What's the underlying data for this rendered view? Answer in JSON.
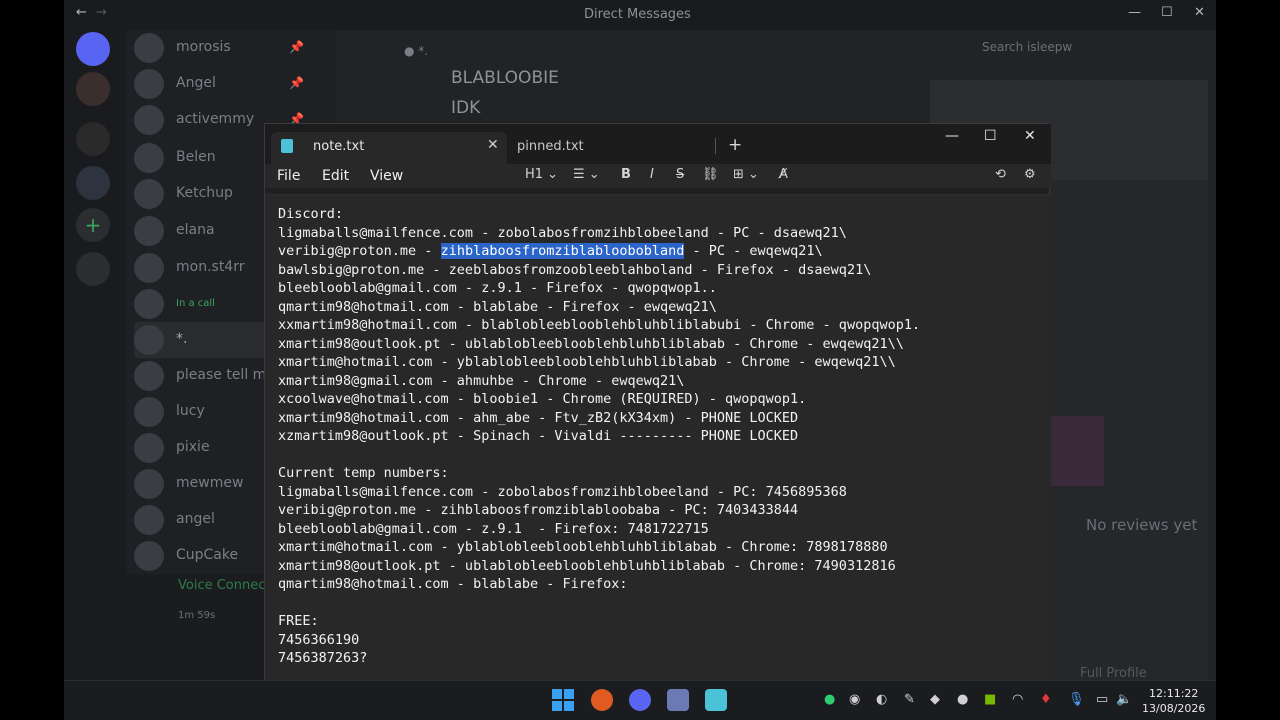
{
  "discord": {
    "title": "Direct Messages",
    "search_placeholder": "Search isleepw",
    "dm_items": [
      {
        "name": "morosis"
      },
      {
        "name": "Angel"
      },
      {
        "name": "activemmy"
      },
      {
        "name": "Belen"
      },
      {
        "name": "Ketchup"
      },
      {
        "name": "elana"
      },
      {
        "name": "mon.st4rr"
      },
      {
        "name": "In a call"
      },
      {
        "name": "*."
      },
      {
        "name": "please tell me"
      },
      {
        "name": "lucy"
      },
      {
        "name": "pixie"
      },
      {
        "name": "mewmew"
      },
      {
        "name": "angel"
      },
      {
        "name": "CupCake"
      }
    ],
    "voice_status": "Voice Connected",
    "voice_timer": "1m 59s",
    "chat_lines": [
      "BLABLOOBIE",
      "IDK"
    ],
    "reviews": "No reviews yet",
    "full_profile": "Full Profile"
  },
  "notepad": {
    "tabs": [
      "note.txt",
      "pinned.txt"
    ],
    "menu": [
      "File",
      "Edit",
      "View"
    ],
    "heading_select": "H1",
    "lines": [
      {
        "pre": "Discord:",
        "sel": "",
        "post": ""
      },
      {
        "pre": "ligmaballs@mailfence.com - zobolabosfromzihblobeeland - PC - dsaewq21\\",
        "sel": "",
        "post": ""
      },
      {
        "pre": "veribig@proton.me - ",
        "sel": "zihblaboosfromziblabloobobland",
        "post": " - PC - ewqewq21\\"
      },
      {
        "pre": "bawlsbig@proton.me - zeeblabosfromzoobleeblahboland - Firefox - dsaewq21\\",
        "sel": "",
        "post": ""
      },
      {
        "pre": "bleeblooblab@gmail.com - z.9.1 - Firefox - qwopqwop1..",
        "sel": "",
        "post": ""
      },
      {
        "pre": "qmartim98@hotmail.com - blablabe - Firefox - ewqewq21\\",
        "sel": "",
        "post": ""
      },
      {
        "pre": "xxmartim98@hotmail.com - blablobleeblooblehbluhbliblabubi - Chrome - qwopqwop1.",
        "sel": "",
        "post": ""
      },
      {
        "pre": "xmartim98@outlook.pt - ublablobleeblooblehbluhbliblabab - Chrome - ewqewq21\\\\",
        "sel": "",
        "post": ""
      },
      {
        "pre": "xmartim@hotmail.com - yblablobleeblooblehbluhbliblabab - Chrome - ewqewq21\\\\",
        "sel": "",
        "post": ""
      },
      {
        "pre": "xmartim98@gmail.com - ahmuhbe - Chrome - ewqewq21\\",
        "sel": "",
        "post": ""
      },
      {
        "pre": "xcoolwave@hotmail.com - bloobie1 - Chrome (REQUIRED) - qwopqwop1.",
        "sel": "",
        "post": ""
      },
      {
        "pre": "xmartim98@hotmail.com - ahm_abe - Ftv_zB2(kX34xm) - PHONE LOCKED",
        "sel": "",
        "post": ""
      },
      {
        "pre": "xzmartim98@outlook.pt - Spinach - Vivaldi --------- PHONE LOCKED",
        "sel": "",
        "post": ""
      },
      {
        "pre": "",
        "sel": "",
        "post": ""
      },
      {
        "pre": "Current temp numbers:",
        "sel": "",
        "post": ""
      },
      {
        "pre": "ligmaballs@mailfence.com - zobolabosfromzihblobeeland - PC: 7456895368",
        "sel": "",
        "post": ""
      },
      {
        "pre": "veribig@proton.me - zihblaboosfromziblabloobaba - PC: 7403433844",
        "sel": "",
        "post": ""
      },
      {
        "pre": "bleeblooblab@gmail.com - z.9.1  - Firefox: 7481722715",
        "sel": "",
        "post": ""
      },
      {
        "pre": "xmartim@hotmail.com - yblablobleeblooblehbluhbliblabab - Chrome: 7898178880",
        "sel": "",
        "post": ""
      },
      {
        "pre": "xmartim98@outlook.pt - ublablobleeblooblehbluhbliblabab - Chrome: 7490312816",
        "sel": "",
        "post": ""
      },
      {
        "pre": "qmartim98@hotmail.com - blablabe - Firefox:",
        "sel": "",
        "post": ""
      },
      {
        "pre": "",
        "sel": "",
        "post": ""
      },
      {
        "pre": "FREE:",
        "sel": "",
        "post": ""
      },
      {
        "pre": "7456366190",
        "sel": "",
        "post": ""
      },
      {
        "pre": "7456387263?",
        "sel": "",
        "post": ""
      }
    ]
  },
  "taskbar": {
    "time": "12:11:22",
    "date": "13/08/2026"
  },
  "colors": {
    "selection": "#2c65c9",
    "editor_bg": "#282828",
    "accent_start": "#3aa0f3"
  }
}
